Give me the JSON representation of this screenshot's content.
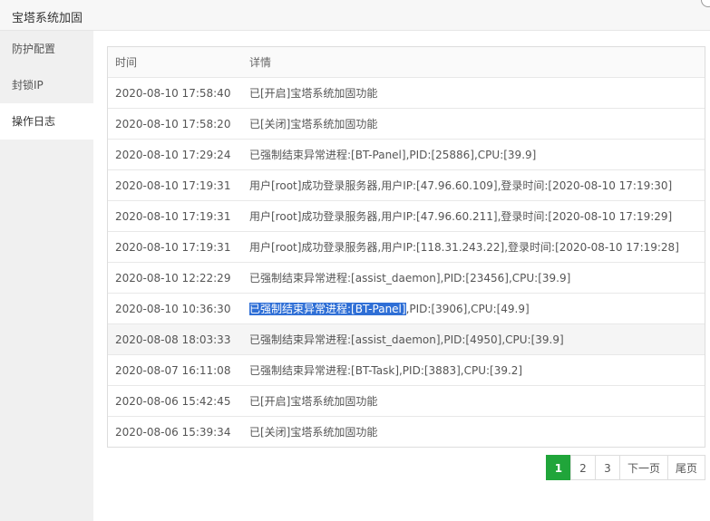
{
  "window": {
    "title": "宝塔系统加固"
  },
  "sidebar": {
    "items": [
      {
        "label": "防护配置"
      },
      {
        "label": "封锁IP"
      },
      {
        "label": "操作日志"
      }
    ]
  },
  "table": {
    "headers": {
      "time": "时间",
      "detail": "详情"
    },
    "rows": [
      {
        "time": "2020-08-10 17:58:40",
        "detail": "已[开启]宝塔系统加固功能"
      },
      {
        "time": "2020-08-10 17:58:20",
        "detail": "已[关闭]宝塔系统加固功能"
      },
      {
        "time": "2020-08-10 17:29:24",
        "detail": "已强制结束异常进程:[BT-Panel],PID:[25886],CPU:[39.9]"
      },
      {
        "time": "2020-08-10 17:19:31",
        "detail": "用户[root]成功登录服务器,用户IP:[47.96.60.109],登录时间:[2020-08-10 17:19:30]"
      },
      {
        "time": "2020-08-10 17:19:31",
        "detail": "用户[root]成功登录服务器,用户IP:[47.96.60.211],登录时间:[2020-08-10 17:19:29]"
      },
      {
        "time": "2020-08-10 17:19:31",
        "detail": "用户[root]成功登录服务器,用户IP:[118.31.243.22],登录时间:[2020-08-10 17:19:28]"
      },
      {
        "time": "2020-08-10 12:22:29",
        "detail": "已强制结束异常进程:[assist_daemon],PID:[23456],CPU:[39.9]"
      },
      {
        "time": "2020-08-10 10:36:30",
        "detail_selected": "已强制结束异常进程:[BT-Panel]",
        "detail": ",PID:[3906],CPU:[49.9]"
      },
      {
        "time": "2020-08-08 18:03:33",
        "detail": "已强制结束异常进程:[assist_daemon],PID:[4950],CPU:[39.9]"
      },
      {
        "time": "2020-08-07 16:11:08",
        "detail": "已强制结束异常进程:[BT-Task],PID:[3883],CPU:[39.2]"
      },
      {
        "time": "2020-08-06 15:42:45",
        "detail": "已[开启]宝塔系统加固功能"
      },
      {
        "time": "2020-08-06 15:39:34",
        "detail": "已[关闭]宝塔系统加固功能"
      }
    ]
  },
  "pagination": {
    "pages": [
      "1",
      "2",
      "3"
    ],
    "current": "1",
    "next_label": "下一页",
    "last_label": "尾页"
  },
  "colors": {
    "accent": "#20a53a",
    "selection": "#2f6fd6"
  }
}
